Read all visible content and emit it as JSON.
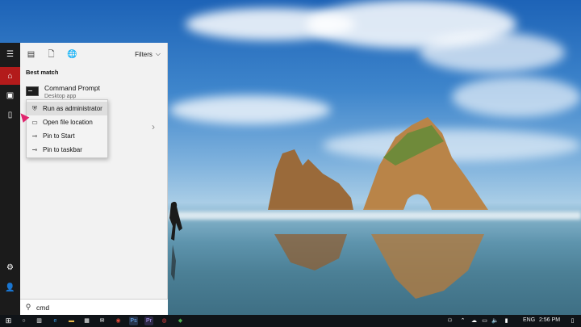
{
  "start_menu": {
    "filters_label": "Filters",
    "section_title": "Best match",
    "best_match": {
      "title": "Command Prompt",
      "subtitle": "Desktop app"
    },
    "context_menu": [
      {
        "label": "Run as administrator",
        "icon": "shield-icon"
      },
      {
        "label": "Open file location",
        "icon": "folder-icon"
      },
      {
        "label": "Pin to Start",
        "icon": "pin-icon"
      },
      {
        "label": "Pin to taskbar",
        "icon": "pin-icon"
      }
    ],
    "search": {
      "value": "cmd"
    }
  },
  "taskbar": {
    "language": "ENG",
    "time": "2:56 PM"
  },
  "colors": {
    "accent": "#b31b1b",
    "taskbar": "#101418",
    "panel": "#f2f2f2",
    "cursor": "#e0256e"
  }
}
